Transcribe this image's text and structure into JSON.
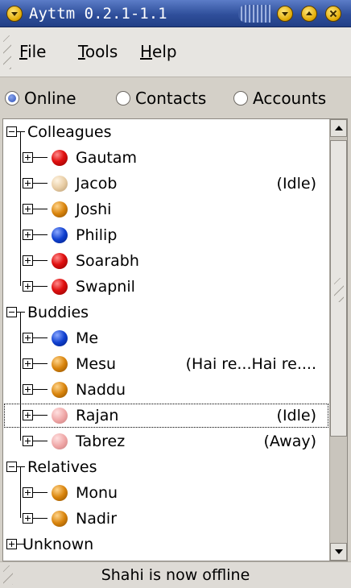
{
  "window": {
    "title": "Ayttm 0.2.1-1.1"
  },
  "menubar": {
    "file": {
      "mnemonic": "F",
      "rest": "ile"
    },
    "tools": {
      "mnemonic": "T",
      "rest": "ools"
    },
    "help": {
      "mnemonic": "H",
      "rest": "elp"
    }
  },
  "view_selector": {
    "options": [
      {
        "label": "Online",
        "checked": true
      },
      {
        "label": "Contacts",
        "checked": false
      },
      {
        "label": "Accounts",
        "checked": false
      }
    ]
  },
  "groups": [
    {
      "name": "Colleagues",
      "expanded": true,
      "contacts": [
        {
          "name": "Gautam",
          "status": "",
          "dot": "red"
        },
        {
          "name": "Jacob",
          "status": "(Idle)",
          "dot": "beige"
        },
        {
          "name": "Joshi",
          "status": "",
          "dot": "orange"
        },
        {
          "name": "Philip",
          "status": "",
          "dot": "blue"
        },
        {
          "name": "Soarabh",
          "status": "",
          "dot": "red"
        },
        {
          "name": "Swapnil",
          "status": "",
          "dot": "red"
        }
      ]
    },
    {
      "name": "Buddies",
      "expanded": true,
      "contacts": [
        {
          "name": "Me",
          "status": "",
          "dot": "blue"
        },
        {
          "name": "Mesu",
          "status": "(Hai re...Hai re....",
          "dot": "orange"
        },
        {
          "name": "Naddu",
          "status": "",
          "dot": "orange"
        },
        {
          "name": "Rajan",
          "status": "(Idle)",
          "dot": "pink",
          "focused": true
        },
        {
          "name": "Tabrez",
          "status": "(Away)",
          "dot": "pink"
        }
      ]
    },
    {
      "name": "Relatives",
      "expanded": true,
      "contacts": [
        {
          "name": "Monu",
          "status": "",
          "dot": "orange"
        },
        {
          "name": "Nadir",
          "status": "",
          "dot": "orange"
        }
      ]
    },
    {
      "name": "Unknown",
      "expanded": false,
      "contacts": []
    }
  ],
  "status_message": "Shahi is now offline",
  "colors": {
    "titlebar": "#2f4f9b",
    "window_bg": "#d4d0c8",
    "list_bg": "#ffffff"
  }
}
